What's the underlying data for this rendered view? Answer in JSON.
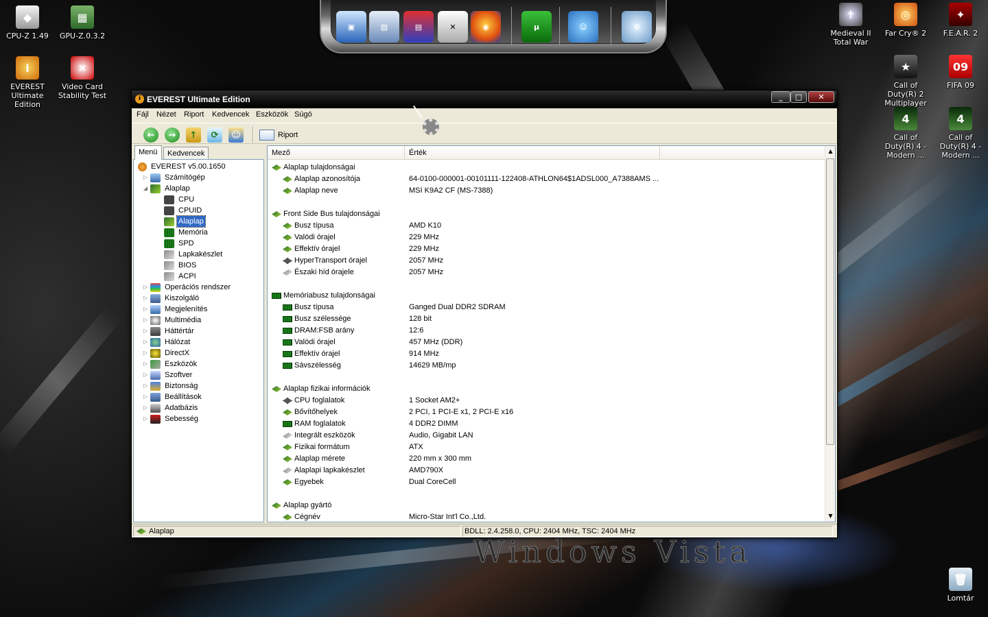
{
  "desktop": {
    "icons": [
      {
        "label": "CPU-Z 1.49",
        "icon": "cpu-z-icon"
      },
      {
        "label": "GPU-Z.0.3.2",
        "icon": "gpu-z-icon"
      },
      {
        "label": "EVEREST Ultimate Edition",
        "icon": "everest-icon"
      },
      {
        "label": "Video Card Stability Test",
        "icon": "video-card-test-icon"
      },
      {
        "label": "Medieval II Total War",
        "icon": "medieval-icon"
      },
      {
        "label": "Far Cry® 2",
        "icon": "far-cry-icon"
      },
      {
        "label": "F.E.A.R. 2",
        "icon": "fear2-icon"
      },
      {
        "label": "Call of Duty(R) 2 Multiplayer",
        "icon": "cod2-icon"
      },
      {
        "label": "FIFA 09",
        "icon": "fifa09-icon"
      },
      {
        "label": "Call of Duty(R) 4 - Modern ...",
        "icon": "cod4-icon"
      },
      {
        "label": "Call of Duty(R) 4 - Modern ...",
        "icon": "cod4-icon"
      },
      {
        "label": "Lomtár",
        "icon": "recycle-bin-icon"
      }
    ],
    "dock": [
      "computer-icon",
      "network-icon",
      "save-icon",
      "xfire-icon",
      "firefox-icon",
      "utorrent-icon",
      "messenger-icon",
      "settings-gear-icon"
    ]
  },
  "window": {
    "title": "EVEREST Ultimate Edition",
    "menu": [
      "Fájl",
      "Nézet",
      "Riport",
      "Kedvencek",
      "Eszközök",
      "Súgó"
    ],
    "toolbar": {
      "report_label": "Riport"
    },
    "tabs": [
      "Menü",
      "Kedvencek"
    ],
    "tree": {
      "root": "EVEREST v5.00.1650",
      "items": [
        {
          "label": "Számítógép",
          "level": 1
        },
        {
          "label": "Alaplap",
          "level": 1,
          "expanded": true
        },
        {
          "label": "CPU",
          "level": 2
        },
        {
          "label": "CPUID",
          "level": 2
        },
        {
          "label": "Alaplap",
          "level": 2,
          "selected": true
        },
        {
          "label": "Memória",
          "level": 2
        },
        {
          "label": "SPD",
          "level": 2
        },
        {
          "label": "Lapkakészlet",
          "level": 2
        },
        {
          "label": "BIOS",
          "level": 2
        },
        {
          "label": "ACPI",
          "level": 2
        },
        {
          "label": "Operációs rendszer",
          "level": 1
        },
        {
          "label": "Kiszolgáló",
          "level": 1
        },
        {
          "label": "Megjelenítés",
          "level": 1
        },
        {
          "label": "Multimédia",
          "level": 1
        },
        {
          "label": "Háttértár",
          "level": 1
        },
        {
          "label": "Hálózat",
          "level": 1
        },
        {
          "label": "DirectX",
          "level": 1
        },
        {
          "label": "Eszközök",
          "level": 1
        },
        {
          "label": "Szoftver",
          "level": 1
        },
        {
          "label": "Biztonság",
          "level": 1
        },
        {
          "label": "Beállítások",
          "level": 1
        },
        {
          "label": "Adatbázis",
          "level": 1
        },
        {
          "label": "Sebesség",
          "level": 1
        }
      ]
    },
    "columns": [
      "Mező",
      "Érték"
    ],
    "rows": [
      {
        "group": "Alaplap tulajdonságai",
        "icon": "mb"
      },
      {
        "field": "Alaplap azonosítója",
        "value": "64-0100-000001-00101111-122408-ATHLON64$1ADSL000_A7388AMS ...",
        "icon": "mb"
      },
      {
        "field": "Alaplap neve",
        "value": "MSI K9A2 CF (MS-7388)",
        "icon": "mb"
      },
      {
        "blank": true
      },
      {
        "group": "Front Side Bus tulajdonságai",
        "icon": "mb"
      },
      {
        "field": "Busz típusa",
        "value": "AMD K10",
        "icon": "mb"
      },
      {
        "field": "Valódi órajel",
        "value": "229 MHz",
        "icon": "mb"
      },
      {
        "field": "Effektív órajel",
        "value": "229 MHz",
        "icon": "mb"
      },
      {
        "field": "HyperTransport órajel",
        "value": "2057 MHz",
        "icon": "chip"
      },
      {
        "field": "Északi híd órajele",
        "value": "2057 MHz",
        "icon": "grey"
      },
      {
        "blank": true
      },
      {
        "group": "Memóriabusz tulajdonságai",
        "icon": "ram"
      },
      {
        "field": "Busz típusa",
        "value": "Ganged Dual DDR2 SDRAM",
        "icon": "ram"
      },
      {
        "field": "Busz szélessége",
        "value": "128 bit",
        "icon": "ram"
      },
      {
        "field": "DRAM:FSB arány",
        "value": "12:6",
        "icon": "ram"
      },
      {
        "field": "Valódi órajel",
        "value": "457 MHz (DDR)",
        "icon": "ram"
      },
      {
        "field": "Effektív órajel",
        "value": "914 MHz",
        "icon": "ram"
      },
      {
        "field": "Sávszélesség",
        "value": "14629 MB/mp",
        "icon": "ram"
      },
      {
        "blank": true
      },
      {
        "group": "Alaplap fizikai információk",
        "icon": "mb"
      },
      {
        "field": "CPU foglalatok",
        "value": "1 Socket AM2+",
        "icon": "chip"
      },
      {
        "field": "Bővítőhelyek",
        "value": "2 PCI, 1 PCI-E x1, 2 PCI-E x16",
        "icon": "mb"
      },
      {
        "field": "RAM foglalatok",
        "value": "4 DDR2 DIMM",
        "icon": "ram"
      },
      {
        "field": "Integrált eszközök",
        "value": "Audio, Gigabit LAN",
        "icon": "grey"
      },
      {
        "field": "Fizikai formátum",
        "value": "ATX",
        "icon": "mb"
      },
      {
        "field": "Alaplap mérete",
        "value": "220 mm x 300 mm",
        "icon": "mb"
      },
      {
        "field": "Alaplapi lapkakészlet",
        "value": "AMD790X",
        "icon": "grey"
      },
      {
        "field": "Egyebek",
        "value": "Dual CoreCell",
        "icon": "mb"
      },
      {
        "blank": true
      },
      {
        "group": "Alaplap gyártó",
        "icon": "mb"
      },
      {
        "field": "Cégnév",
        "value": "Micro-Star Int'l Co.,Ltd.",
        "icon": "mb"
      }
    ],
    "status": {
      "left": "Alaplap",
      "right": "BDLL: 2.4.258.0, CPU: 2404 MHz, TSC: 2404 MHz"
    }
  }
}
